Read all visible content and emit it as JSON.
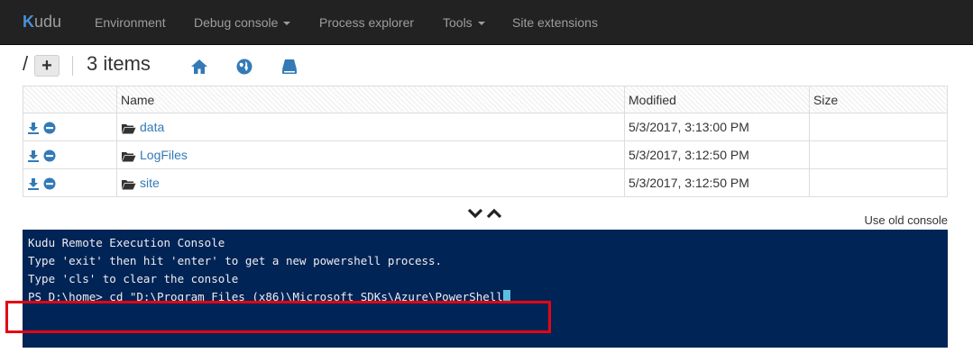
{
  "navbar": {
    "brand": "udu",
    "brand_k": "K",
    "items": [
      {
        "label": "Environment",
        "dropdown": false
      },
      {
        "label": "Debug console",
        "dropdown": true
      },
      {
        "label": "Process explorer",
        "dropdown": false
      },
      {
        "label": "Tools",
        "dropdown": true
      },
      {
        "label": "Site extensions",
        "dropdown": false
      }
    ]
  },
  "breadcrumb": {
    "path": "/",
    "add_label": "+",
    "items_count": "3 items",
    "icons": [
      "home-icon",
      "globe-icon",
      "drive-icon"
    ]
  },
  "file_table": {
    "columns": [
      "",
      "Name",
      "Modified",
      "Size"
    ],
    "rows": [
      {
        "name": "data",
        "modified": "5/3/2017, 3:13:00 PM",
        "size": ""
      },
      {
        "name": "LogFiles",
        "modified": "5/3/2017, 3:12:50 PM",
        "size": ""
      },
      {
        "name": "site",
        "modified": "5/3/2017, 3:12:50 PM",
        "size": ""
      }
    ]
  },
  "console_link": "Use old console",
  "console": {
    "lines": [
      "Kudu Remote Execution Console",
      "Type 'exit' then hit 'enter' to get a new powershell process.",
      "Type 'cls' to clear the console",
      ""
    ],
    "prompt": "PS D:\\home> cd \"D:\\Program Files (x86)\\Microsoft SDKs\\Azure\\PowerShell"
  },
  "colors": {
    "navbar_bg": "#222222",
    "console_bg": "#012456",
    "link": "#337ab7",
    "highlight": "#e30613"
  }
}
